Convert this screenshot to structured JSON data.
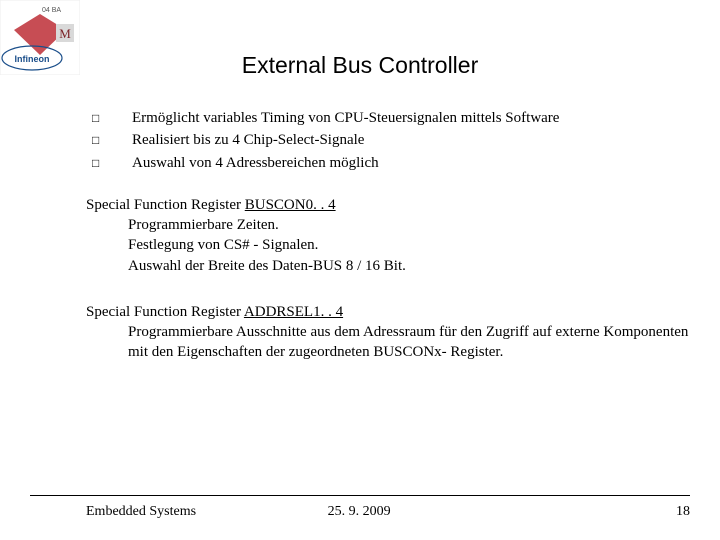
{
  "title": "External Bus Controller",
  "bullets": [
    "Ermöglicht variables Timing von CPU-Steuersignalen mittels Software",
    "Realisiert bis zu 4 Chip-Select-Signale",
    "Auswahl von 4 Adressbereichen möglich"
  ],
  "sections": [
    {
      "head_prefix": "Special Function Register ",
      "head_underlined": "BUSCON0. . 4",
      "lines": [
        "Programmierbare Zeiten.",
        "Festlegung von CS# - Signalen.",
        "Auswahl der Breite des Daten-BUS 8 / 16 Bit."
      ]
    },
    {
      "head_prefix": "Special Function Register ",
      "head_underlined": "ADDRSEL1. . 4",
      "lines": [
        "Programmierbare Ausschnitte aus dem Adressraum für den Zugriff auf externe Komponenten mit den Eigenschaften der zugeordneten BUSCONx- Register."
      ]
    }
  ],
  "footer": {
    "left": "Embedded Systems",
    "center": "25. 9. 2009",
    "right": "18"
  },
  "logo": {
    "label_top": "04 BA",
    "label_m": "M"
  }
}
